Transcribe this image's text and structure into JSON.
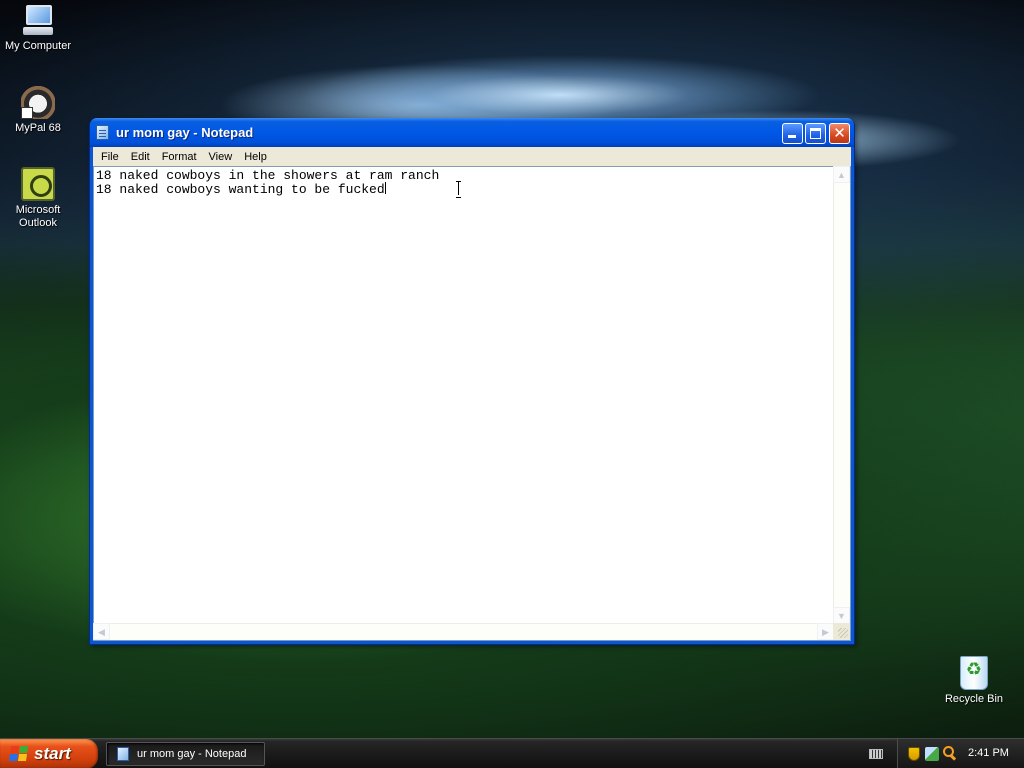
{
  "desktop": {
    "icons": [
      {
        "label": "My Computer",
        "icon": "my-computer-icon"
      },
      {
        "label": "MyPal 68",
        "icon": "mypal-icon"
      },
      {
        "label": "Microsoft Outlook",
        "icon": "outlook-icon"
      },
      {
        "label": "Recycle Bin",
        "icon": "recycle-bin-icon"
      }
    ]
  },
  "window": {
    "title": "ur mom gay - Notepad",
    "menu": [
      "File",
      "Edit",
      "Format",
      "View",
      "Help"
    ],
    "content": {
      "line1": "18 naked cowboys in the showers at ram ranch",
      "line2": "18 naked cowboys wanting to be fucked"
    }
  },
  "taskbar": {
    "start_label": "start",
    "task_label": "ur mom gay - Notepad",
    "clock": "2:41 PM"
  },
  "colors": {
    "titlebar": "#0058e6",
    "start_button": "#d0400c",
    "menubar": "#ece9d8"
  }
}
